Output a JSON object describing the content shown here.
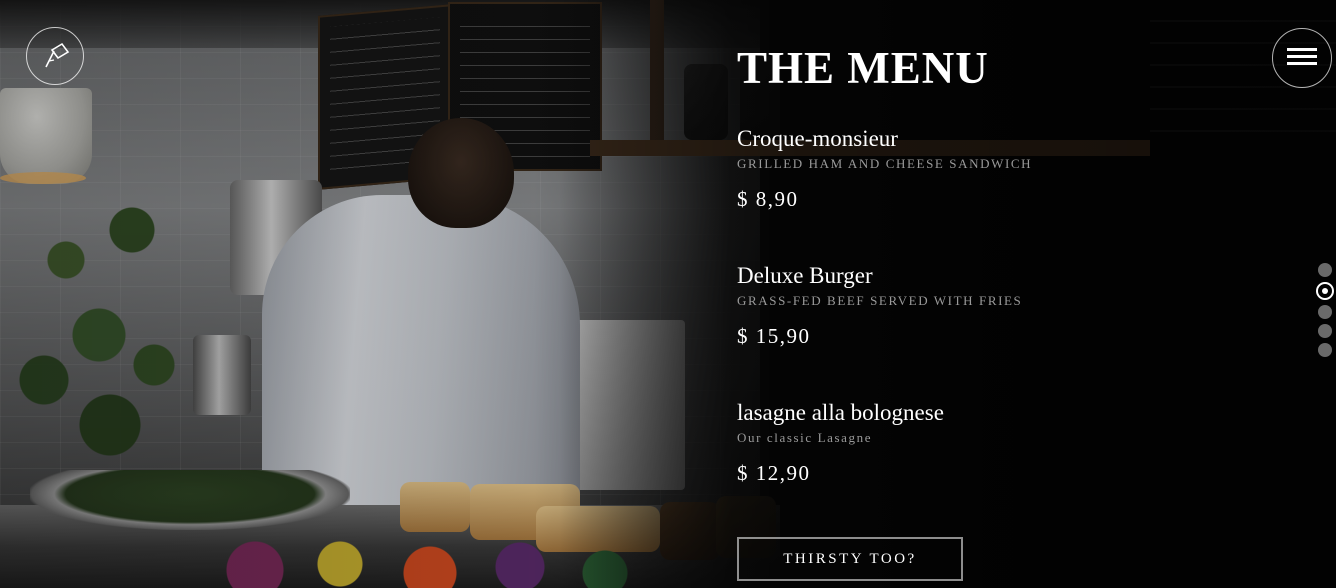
{
  "header": {
    "logo_icon": "flag-logo-icon",
    "menu_icon": "hamburger-icon"
  },
  "menu": {
    "title": "THE MENU",
    "items": [
      {
        "name": "Croque-monsieur",
        "description": "GRILLED HAM AND CHEESE SANDWICH",
        "price": "$ 8,90"
      },
      {
        "name": "Deluxe Burger",
        "description": "GRASS-FED BEEF SERVED WITH FRIES",
        "price": "$ 15,90"
      },
      {
        "name": "lasagne alla bolognese",
        "description": "Our classic Lasagne",
        "price": "$ 12,90"
      }
    ],
    "cta_label": "THIRSTY TOO?"
  },
  "pager": {
    "count": 5,
    "active_index": 1
  },
  "colors": {
    "text": "#ffffff",
    "muted": "#9a9a9a",
    "inactive_dot": "#6a6a6a"
  }
}
